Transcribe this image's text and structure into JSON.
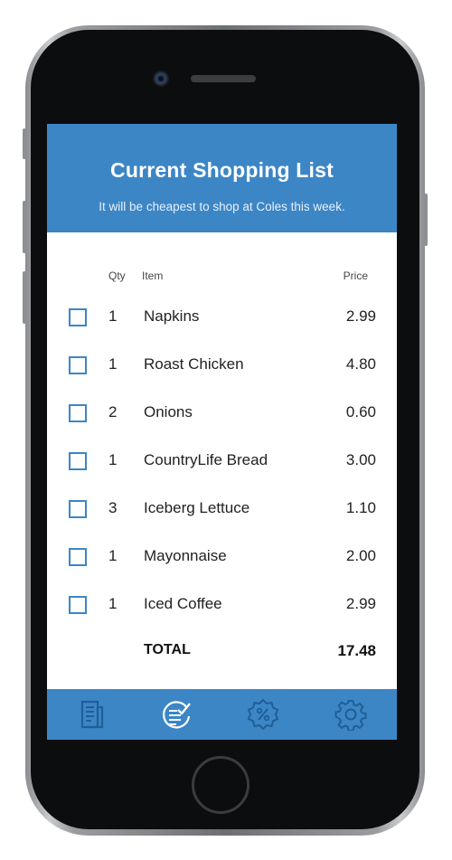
{
  "header": {
    "title": "Current Shopping List",
    "subtitle": "It will be cheapest to shop at Coles this week."
  },
  "columns": {
    "qty": "Qty",
    "item": "Item",
    "price": "Price"
  },
  "items": [
    {
      "qty": "1",
      "name": "Napkins",
      "price": "2.99"
    },
    {
      "qty": "1",
      "name": "Roast Chicken",
      "price": "4.80"
    },
    {
      "qty": "2",
      "name": "Onions",
      "price": "0.60"
    },
    {
      "qty": "1",
      "name": "CountryLife Bread",
      "price": "3.00"
    },
    {
      "qty": "3",
      "name": "Iceberg Lettuce",
      "price": "1.10"
    },
    {
      "qty": "1",
      "name": "Mayonnaise",
      "price": "2.00"
    },
    {
      "qty": "1",
      "name": "Iced Coffee",
      "price": "2.99"
    }
  ],
  "total": {
    "label": "TOTAL",
    "value": "17.48"
  },
  "tabbar": {
    "tabs": [
      {
        "icon": "receipt-icon",
        "active": false
      },
      {
        "icon": "list-check-icon",
        "active": true
      },
      {
        "icon": "discount-badge-icon",
        "active": false
      },
      {
        "icon": "gear-icon",
        "active": false
      }
    ]
  },
  "colors": {
    "accent": "#3c86c6",
    "icon": "#1f5f96",
    "icon_active": "#ffffff"
  }
}
